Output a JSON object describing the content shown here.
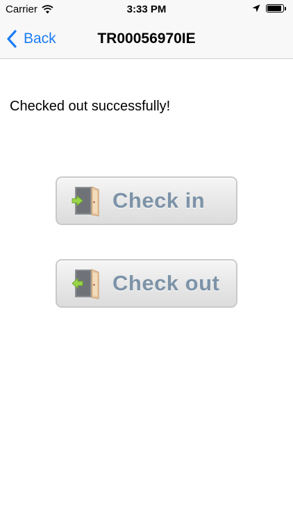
{
  "status_bar": {
    "carrier": "Carrier",
    "time": "3:33 PM",
    "battery_level": 0.9
  },
  "nav": {
    "back_label": "Back",
    "title": "TR00056970IE"
  },
  "message": "Checked out successfully!",
  "buttons": {
    "check_in": "Check in",
    "check_out": "Check out"
  },
  "colors": {
    "accent": "#1a7cf5",
    "button_text": "#7d93a8",
    "arrow": "#9bd64a"
  }
}
